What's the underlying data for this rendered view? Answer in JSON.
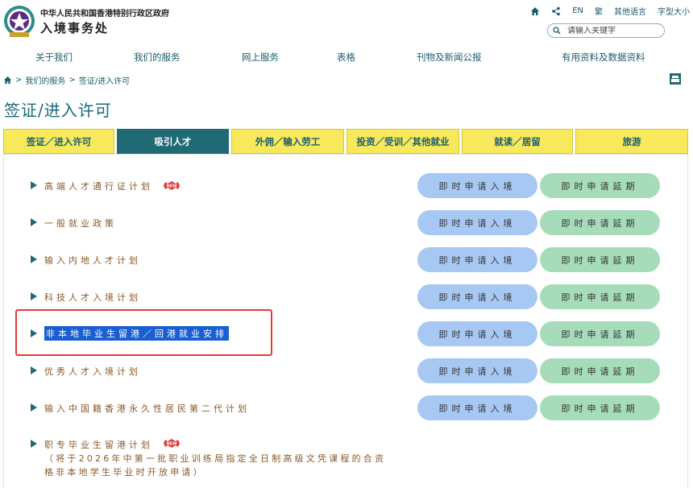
{
  "header": {
    "dept_line1": "中华人民共和国香港特别行政区政府",
    "dept_line2": "入境事务处",
    "toplinks": {
      "lang_en": "EN",
      "lang_trad": "繁",
      "other_lang": "其他语言",
      "font_size": "字型大小"
    },
    "search_placeholder": "请输入关键字"
  },
  "mainnav": [
    "关于我们",
    "我们的服务",
    "网上服务",
    "表格",
    "刊物及新闻公报",
    "有用资料及数据资料"
  ],
  "breadcrumb": {
    "item1": "我们的服务",
    "item2": "签证/进入许可",
    "sep": ">"
  },
  "page_title": "签证/进入许可",
  "tabs": [
    "签证／进入许可",
    "吸引人才",
    "外佣／输入劳工",
    "投资／受训／其他就业",
    "就读／居留",
    "旅游"
  ],
  "buttons": {
    "entry": "即时申请入境",
    "extend": "即时申请延期"
  },
  "items": [
    {
      "title": "高端人才通行证计划",
      "new": true
    },
    {
      "title": "一般就业政策"
    },
    {
      "title": "输入内地人才计划"
    },
    {
      "title": "科技人才入境计划"
    },
    {
      "title": "非本地毕业生留港／回港就业安排"
    },
    {
      "title": "优秀人才入境计划"
    },
    {
      "title": "输入中国籍香港永久性居民第二代计划"
    },
    {
      "title": "职专毕业生留港计划",
      "new": true,
      "note_line1": "（将于2026年中第一批职业训练局指定全日制高级文凭课程的合资",
      "note_line2": "格非本地学生毕业时开放申请）"
    }
  ],
  "colors": {
    "teal": "#1f6a75",
    "tab_yellow": "#f7e85c",
    "entry_blue": "#a8c8f4",
    "extend_green": "#a6dcb9",
    "highlight": "#1a5fd1",
    "box_red": "#e53935"
  }
}
